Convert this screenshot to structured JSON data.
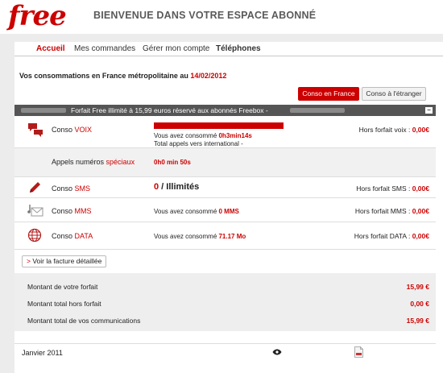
{
  "header": {
    "logo": "free",
    "tagline": "BIENVENUE DANS VOTRE ESPACE ABONNÉ"
  },
  "nav": {
    "items": [
      "Accueil",
      "Mes commandes",
      "Gérer mon compte",
      "Téléphones"
    ]
  },
  "conso": {
    "title_prefix": "Vos consommations en France métropolitaine au ",
    "date": "14/02/2012"
  },
  "buttons": {
    "france": "Conso en France",
    "etranger": "Conso à l'étranger"
  },
  "forfait_bar": {
    "text": "Forfait Free illimité à 15,99 euros réservé aux abonnés Freebox -",
    "collapse": "−"
  },
  "voix": {
    "label": "Conso ",
    "label_red": "VOIX",
    "line1_prefix": "Vous avez consommé ",
    "line1_value": "0h3min14s",
    "line2": "Total appels vers international -",
    "hors_prefix": "Hors forfait voix : ",
    "hors_value": "0,00€"
  },
  "speciaux": {
    "label": "Appels numéros ",
    "label_red": "spéciaux",
    "value": "0h0 min 50s"
  },
  "sms": {
    "label": "Conso ",
    "label_red": "SMS",
    "count": "0",
    "unit": " / Illimités",
    "hors_prefix": "Hors forfait SMS : ",
    "hors_value": "0,00€"
  },
  "mms": {
    "label": "Conso ",
    "label_red": "MMS",
    "line_prefix": "Vous avez consommé ",
    "line_value": "0 MMS",
    "hors_prefix": "Hors forfait MMS : ",
    "hors_value": "0,00€"
  },
  "data": {
    "label": "Conso ",
    "label_red": "DATA",
    "line_prefix": "Vous avez consommé ",
    "line_value": "71.17 Mo",
    "hors_prefix": "Hors forfait DATA : ",
    "hors_value": "0,00€"
  },
  "facture": {
    "arrow": ">",
    "label": " Voir la facture détaillée"
  },
  "totals": [
    {
      "label": "Montant de votre forfait",
      "value": "15,99 €"
    },
    {
      "label": "Montant total hors forfait",
      "value": "0,00 €"
    },
    {
      "label": "Montant total de vos communications",
      "value": "15,99 €"
    }
  ],
  "history": {
    "month": "Janvier 2011"
  },
  "colors": {
    "accent": "#cc0000",
    "bar": "#555555"
  },
  "icons": [
    "speech-bubbles-icon",
    "pencil-icon",
    "music-envelope-icon",
    "globe-icon",
    "eye-icon",
    "pdf-document-icon"
  ]
}
